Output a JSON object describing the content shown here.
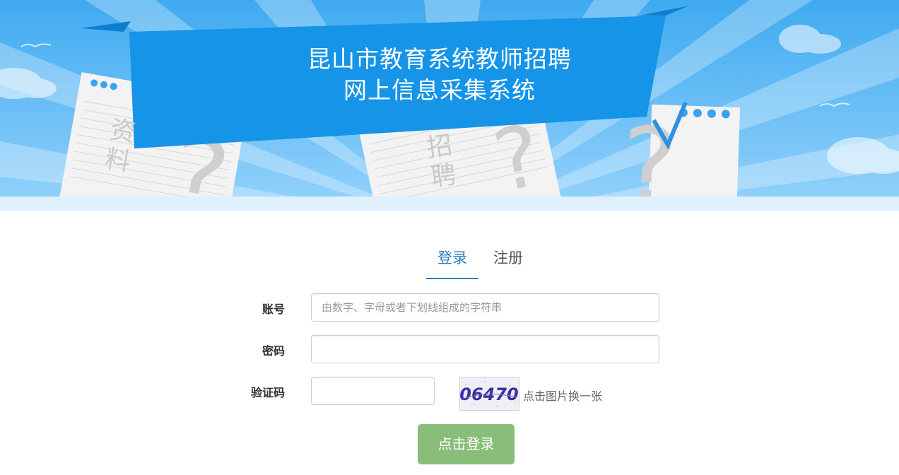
{
  "banner": {
    "title_line1": "昆山市教育系统教师招聘",
    "title_line2": "网上信息采集系统",
    "paper_left_text": "资料",
    "paper_mid_text": "招聘"
  },
  "tabs": [
    {
      "label": "登录",
      "active": true
    },
    {
      "label": "注册",
      "active": false
    }
  ],
  "form": {
    "account": {
      "label": "账号",
      "placeholder": "由数字、字母或者下划线组成的字符串",
      "value": ""
    },
    "password": {
      "label": "密码",
      "placeholder": "",
      "value": ""
    },
    "captcha": {
      "label": "验证码",
      "value": "",
      "image_text": "06470",
      "hint": "点击图片换一张"
    },
    "submit_label": "点击登录"
  },
  "colors": {
    "sky": "#5cb8f5",
    "ribbon": "#1694e8",
    "accent_tab": "#2b7fc2",
    "button": "#89bd7a"
  }
}
